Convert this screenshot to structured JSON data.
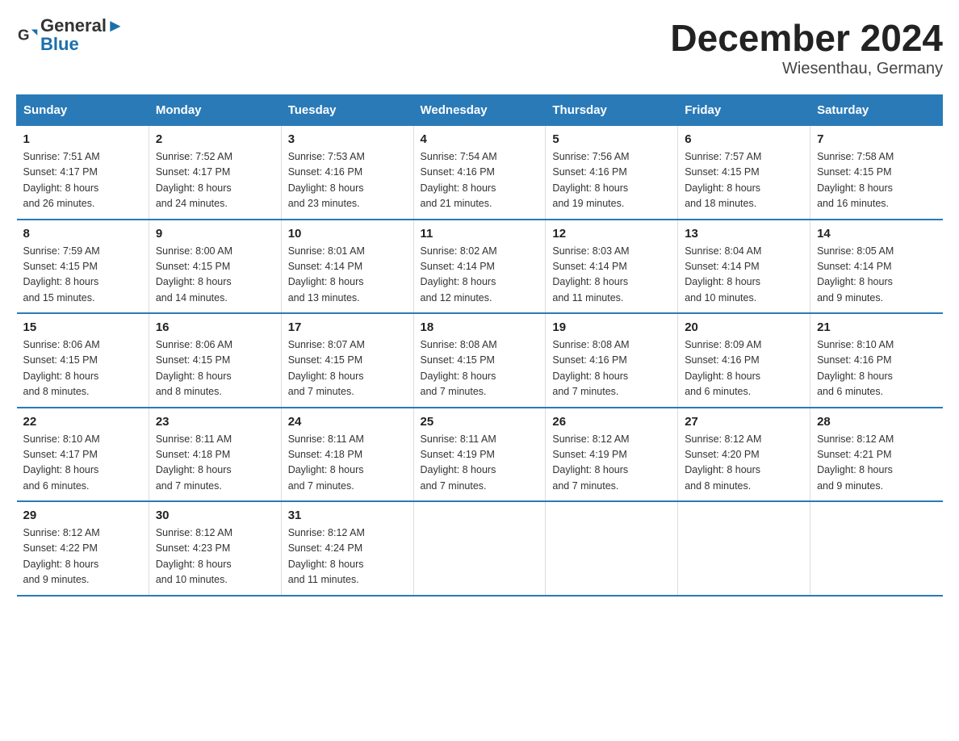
{
  "header": {
    "logo_general": "General",
    "logo_blue": "Blue",
    "title": "December 2024",
    "subtitle": "Wiesenthau, Germany"
  },
  "days_of_week": [
    "Sunday",
    "Monday",
    "Tuesday",
    "Wednesday",
    "Thursday",
    "Friday",
    "Saturday"
  ],
  "weeks": [
    [
      {
        "day": "1",
        "sunrise": "7:51 AM",
        "sunset": "4:17 PM",
        "daylight": "8 hours and 26 minutes."
      },
      {
        "day": "2",
        "sunrise": "7:52 AM",
        "sunset": "4:17 PM",
        "daylight": "8 hours and 24 minutes."
      },
      {
        "day": "3",
        "sunrise": "7:53 AM",
        "sunset": "4:16 PM",
        "daylight": "8 hours and 23 minutes."
      },
      {
        "day": "4",
        "sunrise": "7:54 AM",
        "sunset": "4:16 PM",
        "daylight": "8 hours and 21 minutes."
      },
      {
        "day": "5",
        "sunrise": "7:56 AM",
        "sunset": "4:16 PM",
        "daylight": "8 hours and 19 minutes."
      },
      {
        "day": "6",
        "sunrise": "7:57 AM",
        "sunset": "4:15 PM",
        "daylight": "8 hours and 18 minutes."
      },
      {
        "day": "7",
        "sunrise": "7:58 AM",
        "sunset": "4:15 PM",
        "daylight": "8 hours and 16 minutes."
      }
    ],
    [
      {
        "day": "8",
        "sunrise": "7:59 AM",
        "sunset": "4:15 PM",
        "daylight": "8 hours and 15 minutes."
      },
      {
        "day": "9",
        "sunrise": "8:00 AM",
        "sunset": "4:15 PM",
        "daylight": "8 hours and 14 minutes."
      },
      {
        "day": "10",
        "sunrise": "8:01 AM",
        "sunset": "4:14 PM",
        "daylight": "8 hours and 13 minutes."
      },
      {
        "day": "11",
        "sunrise": "8:02 AM",
        "sunset": "4:14 PM",
        "daylight": "8 hours and 12 minutes."
      },
      {
        "day": "12",
        "sunrise": "8:03 AM",
        "sunset": "4:14 PM",
        "daylight": "8 hours and 11 minutes."
      },
      {
        "day": "13",
        "sunrise": "8:04 AM",
        "sunset": "4:14 PM",
        "daylight": "8 hours and 10 minutes."
      },
      {
        "day": "14",
        "sunrise": "8:05 AM",
        "sunset": "4:14 PM",
        "daylight": "8 hours and 9 minutes."
      }
    ],
    [
      {
        "day": "15",
        "sunrise": "8:06 AM",
        "sunset": "4:15 PM",
        "daylight": "8 hours and 8 minutes."
      },
      {
        "day": "16",
        "sunrise": "8:06 AM",
        "sunset": "4:15 PM",
        "daylight": "8 hours and 8 minutes."
      },
      {
        "day": "17",
        "sunrise": "8:07 AM",
        "sunset": "4:15 PM",
        "daylight": "8 hours and 7 minutes."
      },
      {
        "day": "18",
        "sunrise": "8:08 AM",
        "sunset": "4:15 PM",
        "daylight": "8 hours and 7 minutes."
      },
      {
        "day": "19",
        "sunrise": "8:08 AM",
        "sunset": "4:16 PM",
        "daylight": "8 hours and 7 minutes."
      },
      {
        "day": "20",
        "sunrise": "8:09 AM",
        "sunset": "4:16 PM",
        "daylight": "8 hours and 6 minutes."
      },
      {
        "day": "21",
        "sunrise": "8:10 AM",
        "sunset": "4:16 PM",
        "daylight": "8 hours and 6 minutes."
      }
    ],
    [
      {
        "day": "22",
        "sunrise": "8:10 AM",
        "sunset": "4:17 PM",
        "daylight": "8 hours and 6 minutes."
      },
      {
        "day": "23",
        "sunrise": "8:11 AM",
        "sunset": "4:18 PM",
        "daylight": "8 hours and 7 minutes."
      },
      {
        "day": "24",
        "sunrise": "8:11 AM",
        "sunset": "4:18 PM",
        "daylight": "8 hours and 7 minutes."
      },
      {
        "day": "25",
        "sunrise": "8:11 AM",
        "sunset": "4:19 PM",
        "daylight": "8 hours and 7 minutes."
      },
      {
        "day": "26",
        "sunrise": "8:12 AM",
        "sunset": "4:19 PM",
        "daylight": "8 hours and 7 minutes."
      },
      {
        "day": "27",
        "sunrise": "8:12 AM",
        "sunset": "4:20 PM",
        "daylight": "8 hours and 8 minutes."
      },
      {
        "day": "28",
        "sunrise": "8:12 AM",
        "sunset": "4:21 PM",
        "daylight": "8 hours and 9 minutes."
      }
    ],
    [
      {
        "day": "29",
        "sunrise": "8:12 AM",
        "sunset": "4:22 PM",
        "daylight": "8 hours and 9 minutes."
      },
      {
        "day": "30",
        "sunrise": "8:12 AM",
        "sunset": "4:23 PM",
        "daylight": "8 hours and 10 minutes."
      },
      {
        "day": "31",
        "sunrise": "8:12 AM",
        "sunset": "4:24 PM",
        "daylight": "8 hours and 11 minutes."
      },
      {
        "day": "",
        "sunrise": "",
        "sunset": "",
        "daylight": ""
      },
      {
        "day": "",
        "sunrise": "",
        "sunset": "",
        "daylight": ""
      },
      {
        "day": "",
        "sunrise": "",
        "sunset": "",
        "daylight": ""
      },
      {
        "day": "",
        "sunrise": "",
        "sunset": "",
        "daylight": ""
      }
    ]
  ],
  "labels": {
    "sunrise_prefix": "Sunrise: ",
    "sunset_prefix": "Sunset: ",
    "daylight_prefix": "Daylight: "
  }
}
